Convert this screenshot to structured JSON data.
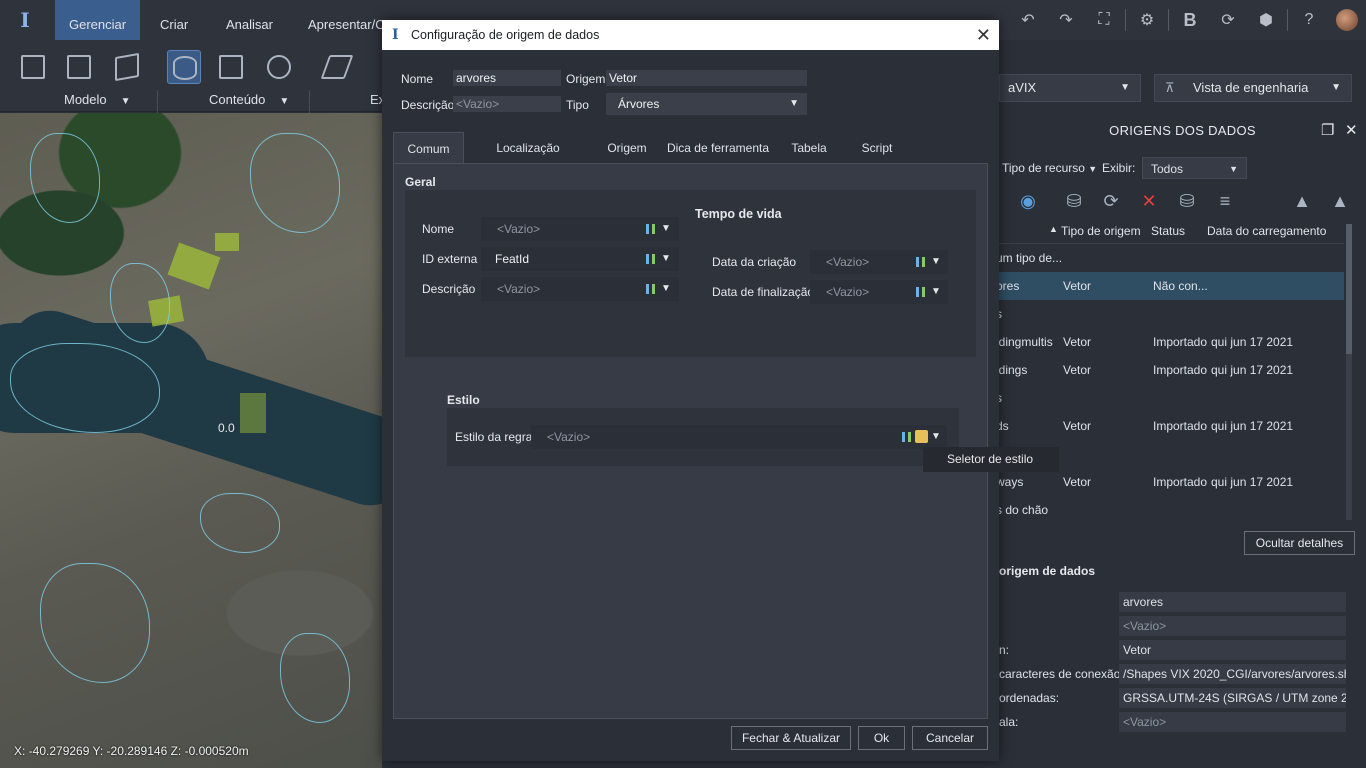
{
  "app": {
    "main_tabs": [
      "Gerenciar",
      "Criar",
      "Analisar",
      "Apresentar/Co"
    ],
    "ribbon_groups": [
      "Modelo",
      "Conteúdo",
      "Ex"
    ],
    "toolbar_icons": [
      "undo-icon",
      "redo-icon",
      "fit-screen-icon",
      "settings-icon",
      "bentley-icon",
      "sync-icon",
      "package-icon",
      "help-icon"
    ]
  },
  "map": {
    "label_0_0": "0.0",
    "coords": "X: -40.279269 Y: -20.289146 Z: -0.000520m"
  },
  "right_panel": {
    "dropdown_left": "aVIX",
    "dropdown_right": "Vista de engenharia",
    "title": "ORIGENS DOS DADOS",
    "filter_resource": "Tipo de recurso",
    "filter_show_label": "Exibir:",
    "filter_show_value": "Todos",
    "columns": [
      "",
      "Tipo de origem",
      "Status",
      "Data do carregamento"
    ],
    "rows": [
      {
        "name": "um tipo de...",
        "type": "",
        "status": "",
        "date": ""
      },
      {
        "name": "ores",
        "type": "Vetor",
        "status": "Não con...",
        "date": ""
      },
      {
        "name": "s",
        "type": "",
        "status": "",
        "date": ""
      },
      {
        "name": "ldingmultis",
        "type": "Vetor",
        "status": "Importado",
        "date": "qui jun 17 2021"
      },
      {
        "name": "ldings",
        "type": "Vetor",
        "status": "Importado",
        "date": "qui jun 17 2021"
      },
      {
        "name": "s",
        "type": "",
        "status": "",
        "date": ""
      },
      {
        "name": "ds",
        "type": "Vetor",
        "status": "Importado",
        "date": "qui jun 17 2021"
      },
      {
        "name": "",
        "type": "",
        "status": "",
        "date": ""
      },
      {
        "name": "ways",
        "type": "Vetor",
        "status": "Importado",
        "date": "qui jun 17 2021"
      },
      {
        "name": "s do chão",
        "type": "",
        "status": "",
        "date": ""
      }
    ],
    "hide_details": "Ocultar detalhes",
    "section_title": "origem de dados",
    "props": [
      {
        "label": "",
        "value": "arvores"
      },
      {
        "label": "",
        "value": "<Vazio>"
      },
      {
        "label": "n:",
        "value": "Vetor"
      },
      {
        "label": "caracteres de conexão:",
        "value": "/Shapes VIX 2020_CGI/arvores/arvores.shp\";"
      },
      {
        "label": "ordenadas:",
        "value": "GRSSA.UTM-24S (SIRGAS / UTM zone 24S)"
      },
      {
        "label": "ala:",
        "value": "<Vazio>"
      }
    ]
  },
  "dialog": {
    "title": "Configuração de origem de dados",
    "nome_label": "Nome",
    "nome_value": "arvores",
    "origem_label": "Origem",
    "origem_value": "Vetor",
    "descricao_label": "Descrição",
    "descricao_value": "<Vazio>",
    "tipo_label": "Tipo",
    "tipo_value": "Árvores",
    "tabs": [
      "Comum",
      "Localização geográfica",
      "Origem",
      "Dica de ferramenta",
      "Tabela",
      "Script"
    ],
    "geral": {
      "title": "Geral",
      "nome_label": "Nome",
      "nome_value": "<Vazio>",
      "id_label": "ID externa",
      "id_value": "FeatId",
      "desc_label": "Descrição",
      "desc_value": "<Vazio>",
      "lifetime_title": "Tempo de vida",
      "created_label": "Data da criação",
      "created_value": "<Vazio>",
      "ended_label": "Data de finalização",
      "ended_value": "<Vazio>"
    },
    "estilo": {
      "title": "Estilo",
      "rule_label": "Estilo da regra",
      "rule_value": "<Vazio>"
    },
    "tooltip": "Seletor de estilo",
    "buttons": {
      "close_update": "Fechar & Atualizar",
      "ok": "Ok",
      "cancel": "Cancelar"
    }
  }
}
